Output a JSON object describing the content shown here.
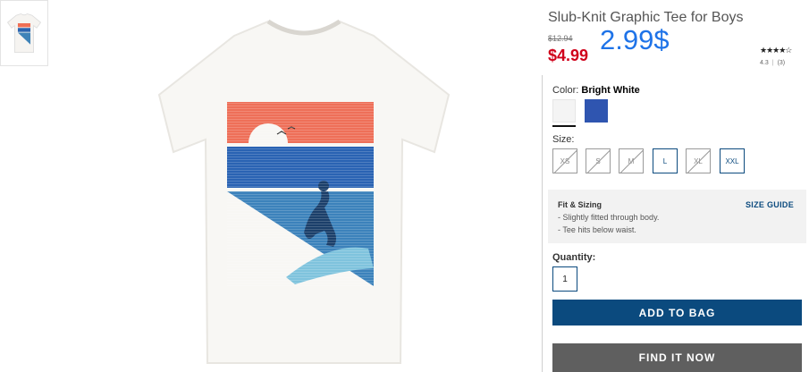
{
  "product": {
    "title": "Slub-Knit Graphic Tee for Boys",
    "original_price": "$12.94",
    "sale_price": "$4.99",
    "handwritten_price": "2.99$",
    "stars": "★★★★☆",
    "rating_value": "4.3",
    "rating_count": "(3)"
  },
  "color": {
    "label": "Color:",
    "selected": "Bright White",
    "swatches": [
      "Bright White",
      "Blue"
    ]
  },
  "size": {
    "label": "Size:",
    "options": [
      {
        "label": "XS",
        "available": false
      },
      {
        "label": "S",
        "available": false
      },
      {
        "label": "M",
        "available": false
      },
      {
        "label": "L",
        "available": true
      },
      {
        "label": "XL",
        "available": false
      },
      {
        "label": "XXL",
        "available": true
      }
    ]
  },
  "fit": {
    "title": "Fit & Sizing",
    "lines": [
      "- Slightly fitted through body.",
      "- Tee hits below waist."
    ],
    "size_guide": "SIZE GUIDE"
  },
  "quantity": {
    "label": "Quantity:",
    "value": "1"
  },
  "buttons": {
    "add_to_bag": "ADD TO BAG",
    "find_it_now": "FIND IT NOW"
  },
  "colors": {
    "sale_red": "#d0021b",
    "brand_navy": "#0b4a7e",
    "handwriting_blue": "#1e73e8"
  }
}
